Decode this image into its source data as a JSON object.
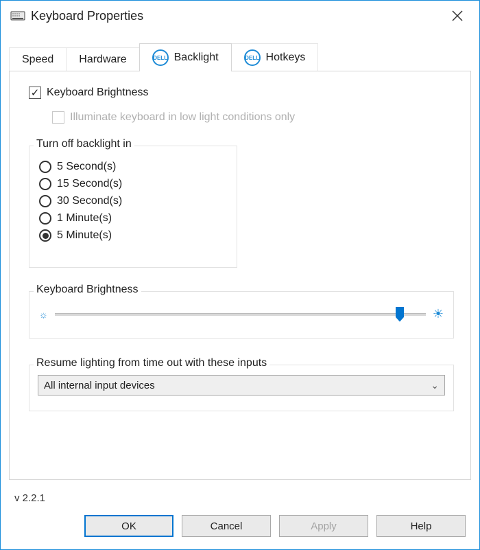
{
  "title": "Keyboard Properties",
  "tabs": {
    "speed": "Speed",
    "hardware": "Hardware",
    "backlight": "Backlight",
    "hotkeys": "Hotkeys"
  },
  "brightness_checkbox_label": "Keyboard Brightness",
  "lowlight_checkbox_label": "Illuminate keyboard in low light conditions only",
  "turnoff": {
    "legend": "Turn off backlight in",
    "options": {
      "o1": "5 Second(s)",
      "o2": "15 Second(s)",
      "o3": "30 Second(s)",
      "o4": "1 Minute(s)",
      "o5": "5 Minute(s)"
    },
    "selected": "o5"
  },
  "brightness_slider": {
    "legend": "Keyboard Brightness",
    "value_percent": 93
  },
  "resume": {
    "legend": "Resume lighting from time out with these inputs",
    "selected": "All internal input devices"
  },
  "version": "v 2.2.1",
  "buttons": {
    "ok": "OK",
    "cancel": "Cancel",
    "apply": "Apply",
    "help": "Help"
  }
}
